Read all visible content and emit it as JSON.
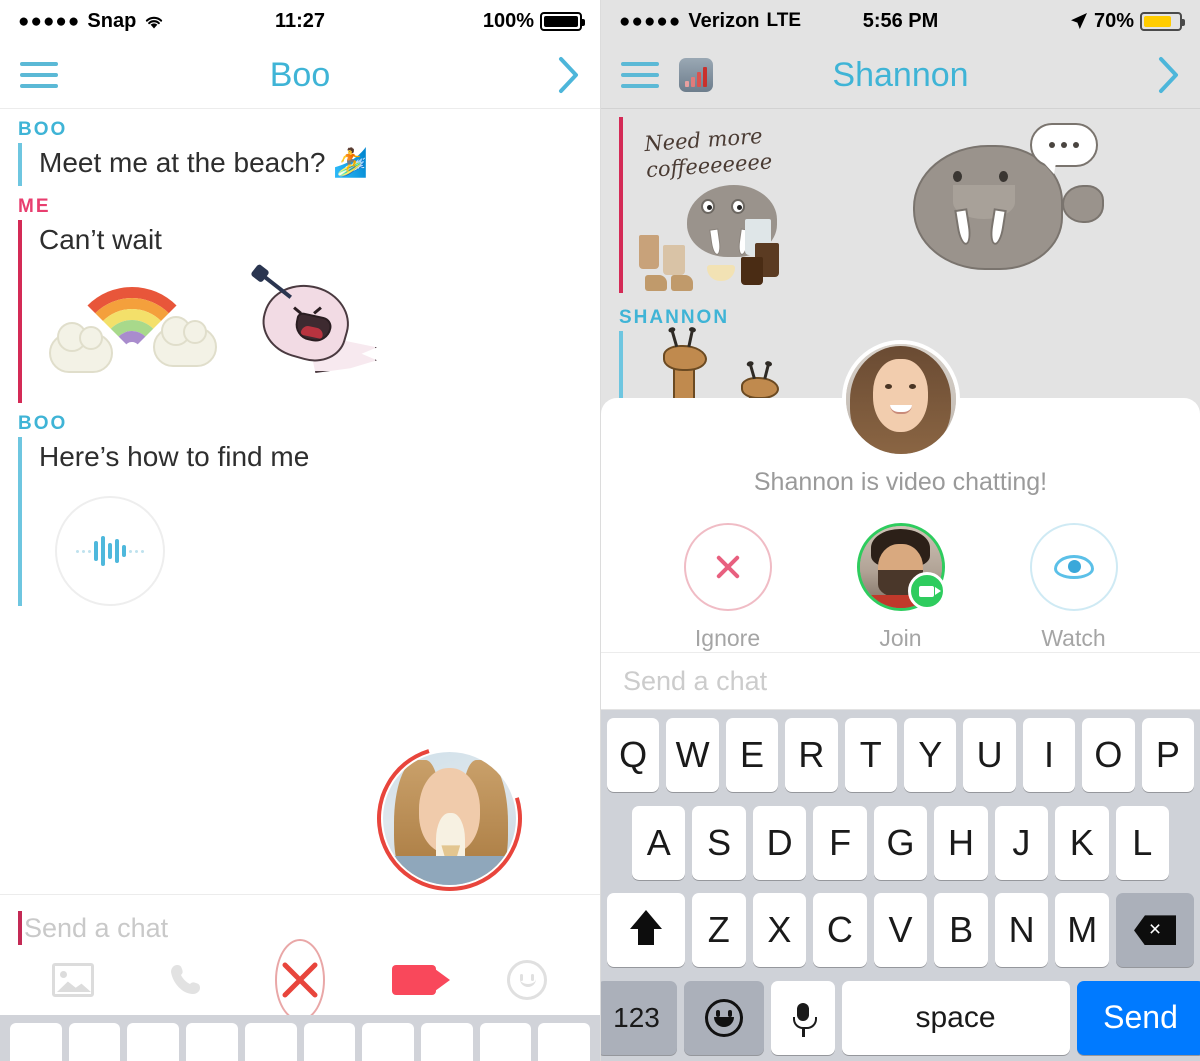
{
  "left_phone": {
    "status_bar": {
      "signal_dots": "●●●●●",
      "carrier": "Snap",
      "wifi_icon": "wifi-icon",
      "time": "11:27",
      "battery_percent": "100%",
      "battery_style": "full"
    },
    "nav": {
      "menu_icon": "hamburger-icon",
      "title": "Boo",
      "forward_icon": "chevron-right-icon"
    },
    "messages": [
      {
        "sender": "BOO",
        "side": "them",
        "text": "Meet me at the beach? 🏄",
        "type": "text"
      },
      {
        "sender": "ME",
        "side": "me",
        "text": "Can’t wait",
        "type": "text"
      },
      {
        "sender": "ME",
        "side": "me",
        "text": "",
        "type": "stickers",
        "stickers": [
          "rainbow-sticker",
          "ghost-sticker"
        ]
      },
      {
        "sender": "BOO",
        "side": "them",
        "text": "Here’s how to find me",
        "type": "text"
      },
      {
        "sender": "BOO",
        "side": "them",
        "text": "",
        "type": "audio-note",
        "audio_icon": "waveform-icon"
      }
    ],
    "selfie": {
      "name": "selfie-bubble",
      "ring_color": "#e8453c"
    },
    "compose": {
      "placeholder": "Send a chat",
      "caret_color": "#c42a55"
    },
    "toolbar": [
      {
        "name": "photo-icon",
        "label": "Photos"
      },
      {
        "name": "phone-icon",
        "label": "Call"
      },
      {
        "name": "close-icon",
        "label": "Close"
      },
      {
        "name": "video-camera-icon",
        "label": "Video"
      },
      {
        "name": "smiley-icon",
        "label": "Stickers"
      }
    ],
    "keyboard_peek_keys": 10
  },
  "right_phone": {
    "status_bar": {
      "signal_dots": "●●●●●",
      "carrier": "Verizon",
      "network": "LTE",
      "location_icon": "location-arrow-icon",
      "time": "5:56 PM",
      "battery_percent": "70%",
      "battery_style": "yellow"
    },
    "nav": {
      "menu_icon": "hamburger-icon",
      "signal_tile_icon": "signal-bars-icon",
      "title": "Shannon",
      "forward_icon": "chevron-right-icon"
    },
    "messages": [
      {
        "sender": "",
        "side": "me",
        "type": "sticker",
        "sticker_name": "coffee-walrus-sticker",
        "caption_line_1": "Need more",
        "caption_line_2": "coffeeeeeee",
        "second_sticker": "walrus-sticker"
      },
      {
        "sender": "SHANNON",
        "side": "them",
        "type": "sticker",
        "sticker_name": "giraffes-sticker"
      }
    ],
    "video_chat_card": {
      "avatar_name": "shannon-avatar",
      "title": "Shannon is video chatting!",
      "actions": [
        {
          "name": "ignore-button",
          "icon": "x-icon",
          "label": "Ignore"
        },
        {
          "name": "join-button",
          "icon": "video-camera-badge-icon",
          "label": "Join"
        },
        {
          "name": "watch-button",
          "icon": "eye-icon",
          "label": "Watch"
        }
      ]
    },
    "compose": {
      "placeholder": "Send a chat"
    },
    "keyboard": {
      "row1": [
        "Q",
        "W",
        "E",
        "R",
        "T",
        "Y",
        "U",
        "I",
        "O",
        "P"
      ],
      "row2": [
        "A",
        "S",
        "D",
        "F",
        "G",
        "H",
        "J",
        "K",
        "L"
      ],
      "row3": [
        "Z",
        "X",
        "C",
        "V",
        "B",
        "N",
        "M"
      ],
      "shift_icon": "shift-icon",
      "delete_icon": "delete-icon",
      "numbers_key": "123",
      "emoji_icon": "emoji-icon",
      "mic_icon": "microphone-icon",
      "space_key": "space",
      "send_key": "Send"
    }
  },
  "colors": {
    "accent_blue": "#3fb4d6",
    "accent_pink": "#e83e6f",
    "accent_red": "#e8453c",
    "send_blue": "#007aff",
    "join_green": "#2ecc5e",
    "battery_yellow": "#ffcc00"
  }
}
